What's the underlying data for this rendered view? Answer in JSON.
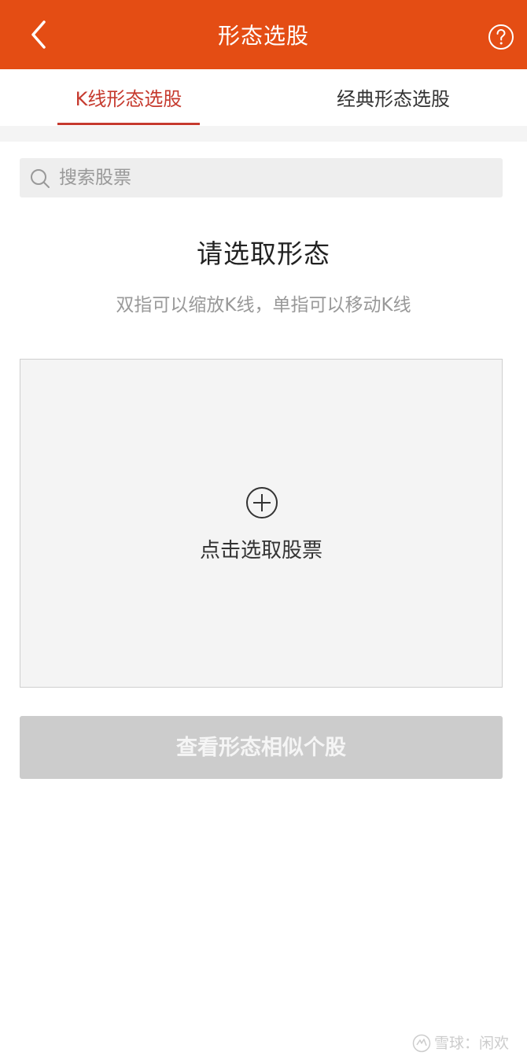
{
  "header": {
    "title": "形态选股",
    "back_icon": "chevron-left-icon",
    "help_icon": "question-circle-icon"
  },
  "tabs": [
    {
      "label": "K线形态选股",
      "active": true
    },
    {
      "label": "经典形态选股",
      "active": false
    }
  ],
  "search": {
    "placeholder": "搜索股票",
    "value": ""
  },
  "selection": {
    "title": "请选取形态",
    "hint": "双指可以缩放K线，单指可以移动K线"
  },
  "pick_area": {
    "label": "点击选取股票",
    "icon": "plus-circle-icon"
  },
  "action": {
    "label": "查看形态相似个股",
    "enabled": false
  },
  "watermark": {
    "text": "雪球：闲欢"
  },
  "colors": {
    "header_bg": "#e44d14",
    "accent": "#c63a2e",
    "disabled_button": "#cccccc"
  }
}
